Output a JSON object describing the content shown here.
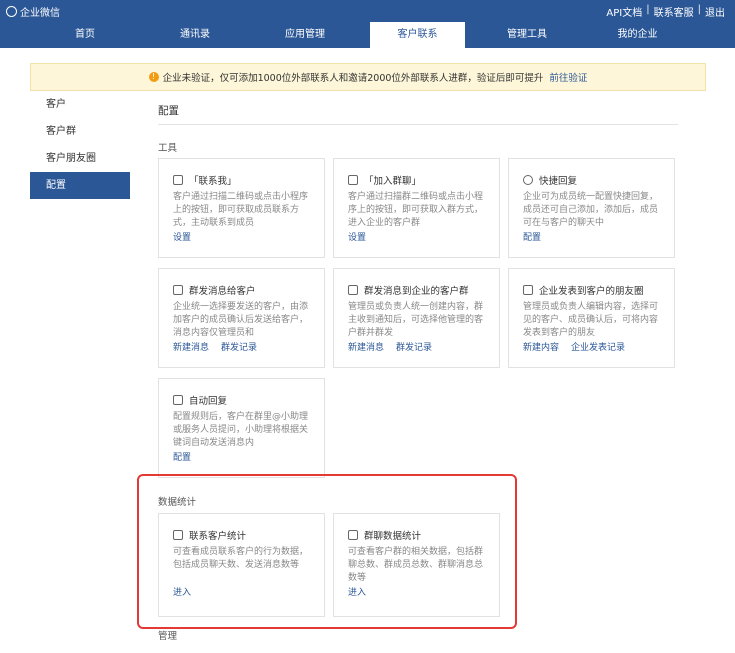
{
  "topbar": {
    "logo_text": "企业微信",
    "links": [
      "API文档",
      "联系客服",
      "退出"
    ],
    "separator": "|"
  },
  "nav": {
    "items": [
      "首页",
      "通讯录",
      "应用管理",
      "客户联系",
      "管理工具",
      "我的企业"
    ],
    "active": "客户联系"
  },
  "notice": {
    "text": "企业未验证，仅可添加1000位外部联系人和邀请2000位外部联系人进群，验证后即可提升",
    "link": "前往验证"
  },
  "sidebar": {
    "items": [
      "客户",
      "客户群",
      "客户朋友圈",
      "配置"
    ],
    "active": "配置"
  },
  "main": {
    "title": "配置",
    "sections": {
      "tools": "工具",
      "stats": "数据统计",
      "manage": "管理"
    },
    "cards": [
      {
        "icon": "contact-me-icon",
        "title": "「联系我」",
        "desc": "客户通过扫描二维码或点击小程序上的按钮，即可获取成员联系方式，主动联系到成员",
        "actions": [
          "设置"
        ]
      },
      {
        "icon": "join-group-icon",
        "title": "「加入群聊」",
        "desc": "客户通过扫描群二维码或点击小程序上的按钮，即可获取入群方式，进入企业的客户群",
        "actions": [
          "设置"
        ]
      },
      {
        "icon": "quick-reply-icon",
        "title": "快捷回复",
        "desc": "企业可为成员统一配置快捷回复，成员还可自己添加，添加后，成员可在与客户的聊天中",
        "actions": [
          "配置"
        ]
      },
      {
        "icon": "broadcast-icon",
        "title": "群发消息给客户",
        "desc": "企业统一选择要发送的客户，由添加客户的成员确认后发送给客户，消息内容仅管理员和",
        "actions": [
          "新建消息",
          "群发记录"
        ]
      },
      {
        "icon": "group-broadcast-icon",
        "title": "群发消息到企业的客户群",
        "desc": "管理员或负责人统一创建内容，群主收到通知后，可选择他管理的客户群并群发",
        "actions": [
          "新建消息",
          "群发记录"
        ]
      },
      {
        "icon": "moments-icon",
        "title": "企业发表到客户的朋友圈",
        "desc": "管理员或负责人编辑内容，选择可见的客户、成员确认后，可将内容发表到客户的朋友",
        "actions": [
          "新建内容",
          "企业发表记录"
        ]
      },
      {
        "icon": "auto-reply-icon",
        "title": "自动回复",
        "desc": "配置规则后，客户在群里@小助理或服务人员提问，小助理将根据关键词自动发送消息内",
        "actions": [
          "配置"
        ]
      },
      {
        "icon": "contact-stats-icon",
        "title": "联系客户统计",
        "desc": "可查看成员联系客户的行为数据，包括成员聊天数、发送消息数等",
        "actions": [
          "进入"
        ]
      },
      {
        "icon": "group-stats-icon",
        "title": "群聊数据统计",
        "desc": "可查看客户群的相关数据，包括群聊总数、群成员总数、群聊消息总数等",
        "actions": [
          "进入"
        ]
      }
    ]
  },
  "colors": {
    "brand": "#2b5797",
    "notice_bg": "#fdf6d8",
    "highlight": "#e53935"
  }
}
